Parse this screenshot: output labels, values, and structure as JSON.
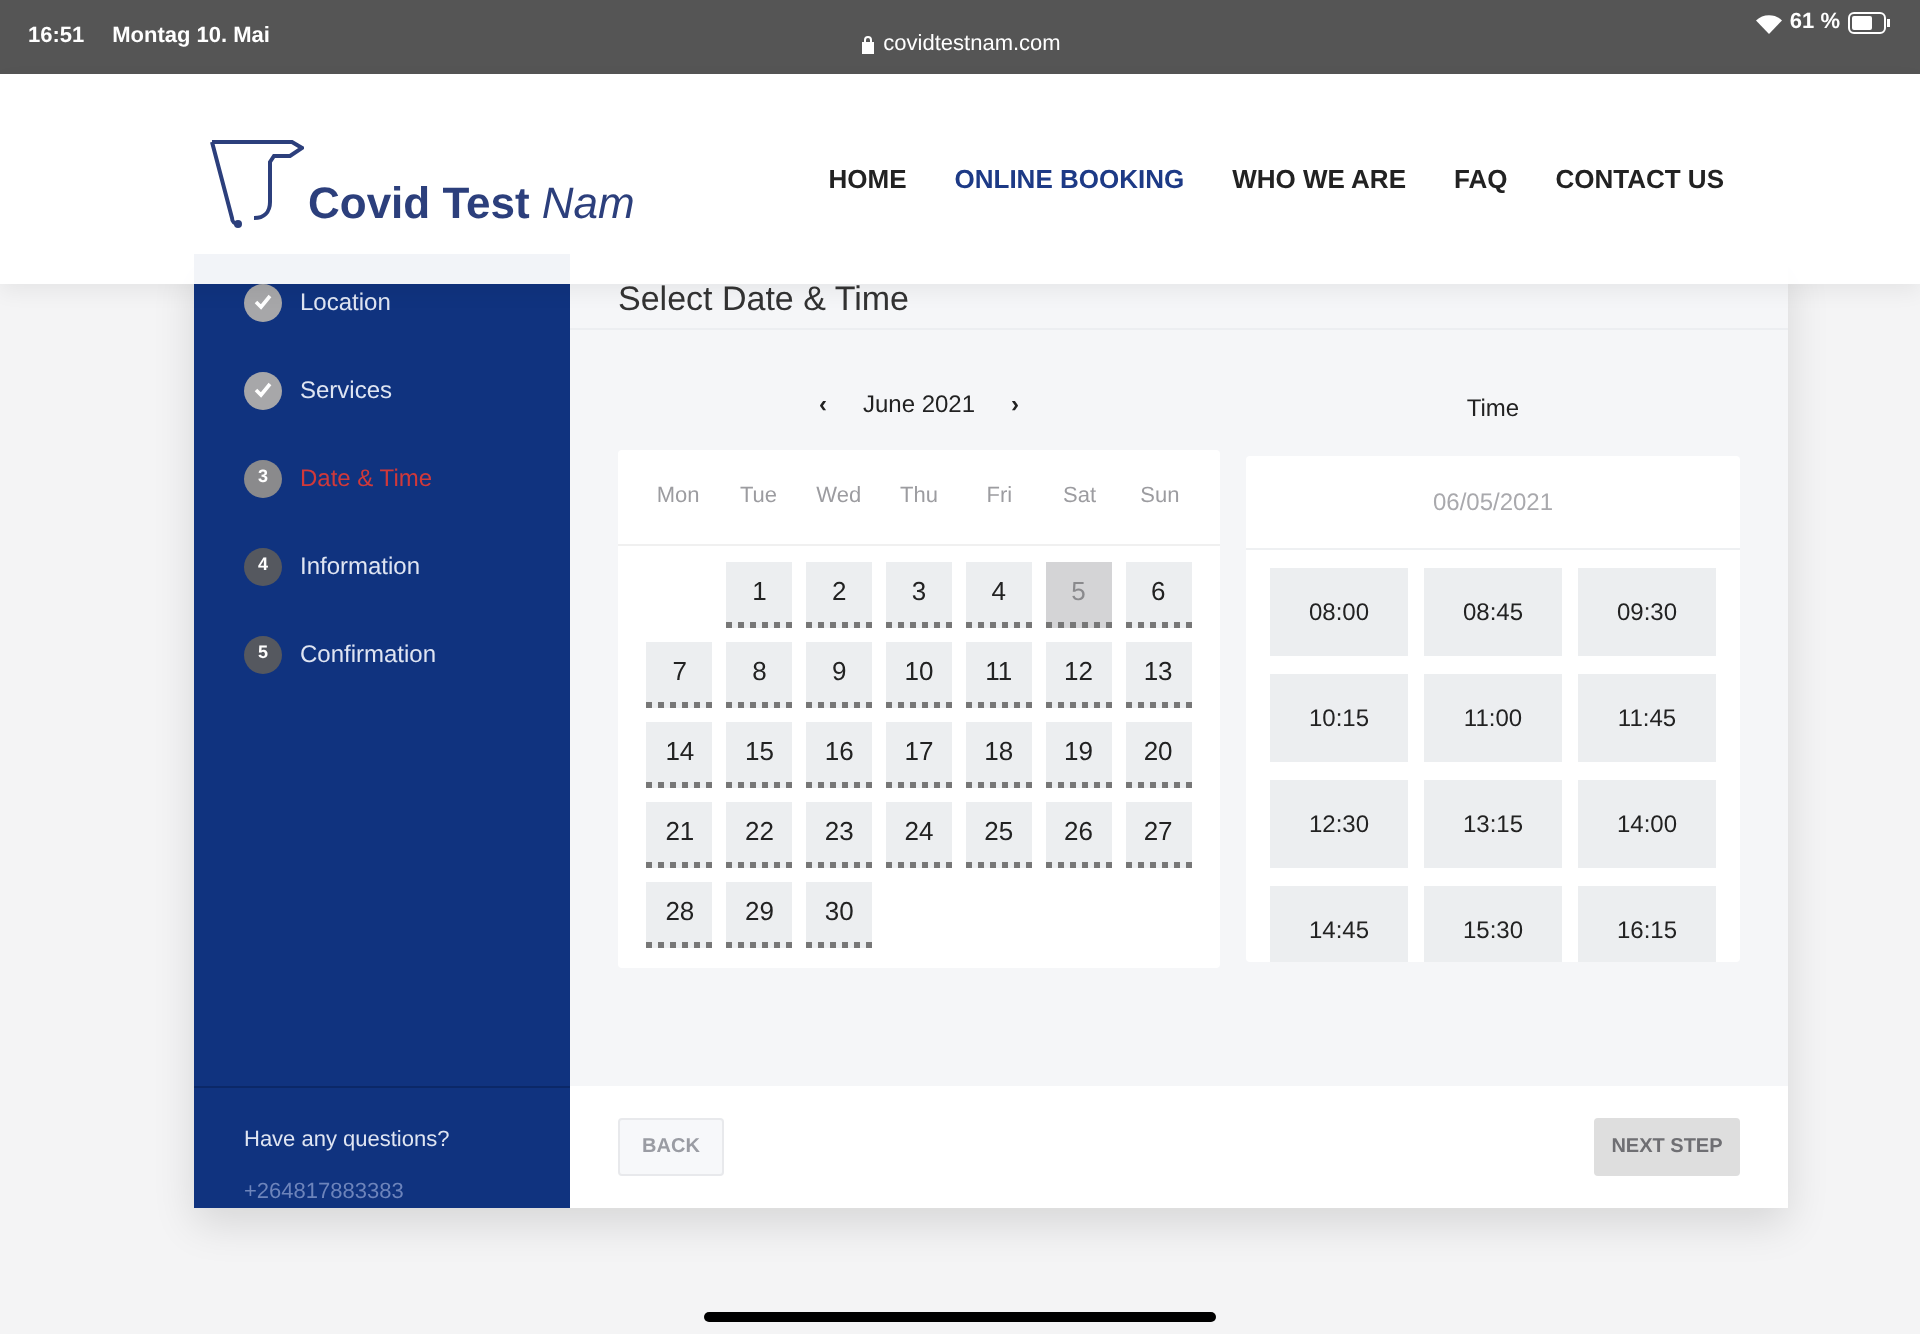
{
  "status_bar": {
    "time": "16:51",
    "date": "Montag 10. Mai",
    "url": "covidtestnam.com",
    "battery": "61 %"
  },
  "header": {
    "logo": {
      "main": "Covid Test",
      "accent": "Nam"
    },
    "nav": [
      {
        "label": "HOME",
        "selected": false
      },
      {
        "label": "ONLINE BOOKING",
        "selected": true
      },
      {
        "label": "WHO WE ARE",
        "selected": false
      },
      {
        "label": "FAQ",
        "selected": false
      },
      {
        "label": "CONTACT US",
        "selected": false
      }
    ]
  },
  "steps": [
    {
      "label": "Location",
      "kind": "done"
    },
    {
      "label": "Services",
      "kind": "done"
    },
    {
      "number": "3",
      "label": "Date & Time",
      "kind": "current"
    },
    {
      "number": "4",
      "label": "Information",
      "kind": "pending"
    },
    {
      "number": "5",
      "label": "Confirmation",
      "kind": "pending"
    }
  ],
  "sidebar_footer": {
    "question": "Have any questions?",
    "phone": "+264817883383"
  },
  "heading": "Select Date & Time",
  "calendar": {
    "month": "June 2021",
    "prev": "‹",
    "next": "›",
    "weekdays": [
      "Mon",
      "Tue",
      "Wed",
      "Thu",
      "Fri",
      "Sat",
      "Sun"
    ],
    "days": [
      {
        "label": "1",
        "disabled": false
      },
      {
        "label": "2",
        "disabled": false
      },
      {
        "label": "3",
        "disabled": false
      },
      {
        "label": "4",
        "disabled": false
      },
      {
        "label": "5",
        "disabled": true
      },
      {
        "label": "6",
        "disabled": false
      },
      {
        "label": "7",
        "disabled": false
      },
      {
        "label": "8",
        "disabled": false
      },
      {
        "label": "9",
        "disabled": false
      },
      {
        "label": "10",
        "disabled": false
      },
      {
        "label": "11",
        "disabled": false
      },
      {
        "label": "12",
        "disabled": false
      },
      {
        "label": "13",
        "disabled": false
      },
      {
        "label": "14",
        "disabled": false
      },
      {
        "label": "15",
        "disabled": false
      },
      {
        "label": "16",
        "disabled": false
      },
      {
        "label": "17",
        "disabled": false
      },
      {
        "label": "18",
        "disabled": false
      },
      {
        "label": "19",
        "disabled": false
      },
      {
        "label": "20",
        "disabled": false
      },
      {
        "label": "21",
        "disabled": false
      },
      {
        "label": "22",
        "disabled": false
      },
      {
        "label": "23",
        "disabled": false
      },
      {
        "label": "24",
        "disabled": false
      },
      {
        "label": "25",
        "disabled": false
      },
      {
        "label": "26",
        "disabled": false
      },
      {
        "label": "27",
        "disabled": false
      },
      {
        "label": "28",
        "disabled": false
      },
      {
        "label": "29",
        "disabled": false
      },
      {
        "label": "30",
        "disabled": false
      }
    ]
  },
  "time": {
    "title": "Time",
    "date": "06/05/2021",
    "slots": [
      "08:00",
      "08:45",
      "09:30",
      "10:15",
      "11:00",
      "11:45",
      "12:30",
      "13:15",
      "14:00",
      "14:45",
      "15:30",
      "16:15"
    ]
  },
  "buttons": {
    "back": "BACK",
    "next": "NEXT STEP"
  }
}
